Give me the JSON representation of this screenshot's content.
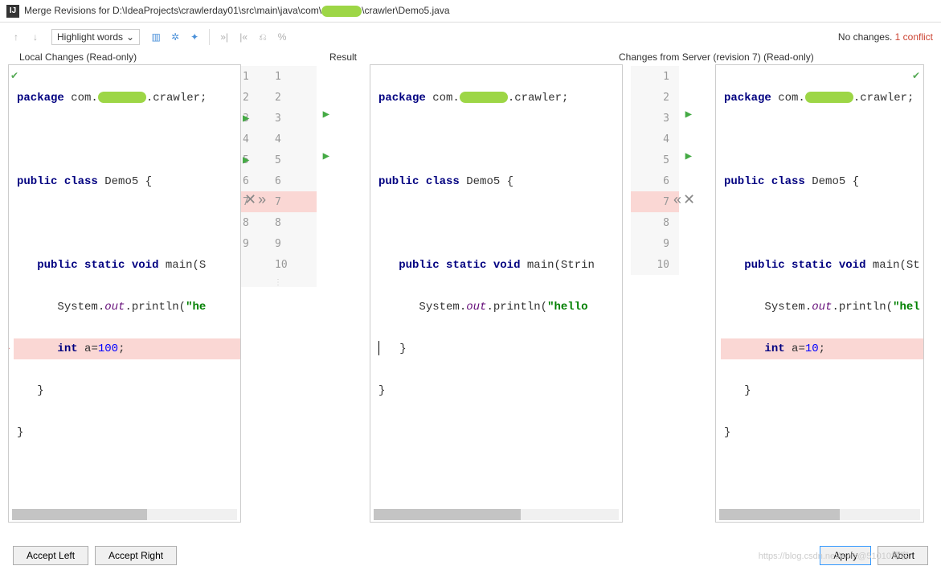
{
  "title_prefix": "Merge Revisions for D:\\IdeaProjects\\crawlerday01\\src\\main\\java\\com\\",
  "title_suffix": "\\crawler\\Demo5.java",
  "toolbar": {
    "highlight_label": "Highlight words",
    "status_nochanges": "No changes.",
    "status_conflict": "1 conflict"
  },
  "headers": {
    "left": "Local Changes (Read-only)",
    "center": "Result",
    "right": "Changes from Server (revision 7) (Read-only)"
  },
  "code": {
    "pkg_kw": "package",
    "pkg_com": " com.",
    "pkg_crawler": ".crawler;",
    "pub": "public",
    "cls": "class",
    "demo": " Demo5 {",
    "static": "static",
    "void": "void",
    "main_left": " main(S",
    "main_center": " main(Strin",
    "main_right": " main(St",
    "sys": "System.",
    "out": "out",
    "println": ".println(",
    "str_he": "\"he",
    "str_hello": "\"hello",
    "str_hel": "\"hel",
    "int": "int",
    "a100": " a=",
    "n100": "100",
    "a10": " a=",
    "n10": "10",
    "semi": ";",
    "brace_close": "}",
    "brace_close_i1": "   }",
    "brace_close_i2": "      }"
  },
  "gutters": {
    "left": [
      "1",
      "2",
      "3",
      "4",
      "5",
      "6",
      "7",
      "8",
      "9",
      "10"
    ],
    "right": [
      "1",
      "2",
      "3",
      "4",
      "5",
      "6",
      "7",
      "8",
      "9",
      "10"
    ]
  },
  "buttons": {
    "accept_left": "Accept Left",
    "accept_right": "Accept Right",
    "apply": "Apply",
    "abort": "Abort"
  },
  "watermark": "https://blog.csdn.net/weix@51010博客"
}
